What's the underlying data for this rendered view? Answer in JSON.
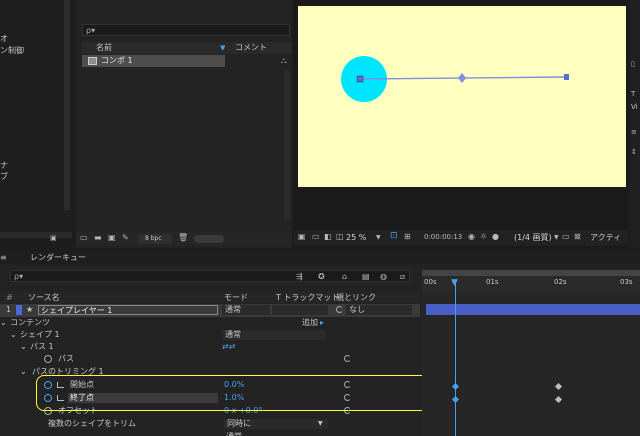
{
  "left_panel": {
    "frag1": "オ",
    "frag2": "ン制御",
    "frag3": "ナ",
    "frag4": "ブ"
  },
  "project": {
    "search_placeholder": "ρ▾",
    "col_name": "名前",
    "col_comment": "コメント",
    "item_name": "コンポ 1",
    "bpc": "8 bpc"
  },
  "viewer": {
    "zoom": "25 %",
    "timecode": "0:00:00:13",
    "resolution": "(1/4 画質)",
    "active": "アクティ",
    "right_frag": "Vi"
  },
  "timeline": {
    "tab_label": "レンダーキュー",
    "search_placeholder": "ρ▾",
    "col_source": "ソース名",
    "col_mode": "モード",
    "col_track": "T  トラックマット",
    "col_parent": "親とリンク",
    "ruler": [
      "00s",
      "01s",
      "02s",
      "03s"
    ],
    "layer": {
      "index": "1",
      "name": "シェイプレイヤー 1",
      "mode": "通常",
      "parent": "なし"
    },
    "contents": "コンテンツ",
    "add_label": "追加",
    "shape1": "シェイプ 1",
    "shape1_mode": "通常",
    "path1": "パス 1",
    "path": "パス",
    "trim": "パスのトリミング 1",
    "start_label": "開始点",
    "start_value": "0.0%",
    "end_label": "終了点",
    "end_value": "1.0%",
    "offset_label": "オフセット",
    "offset_value": "0 x +0.0°",
    "multi_trim": "複数のシェイプをトリム",
    "multi_trim_value": "同時に",
    "bottom_value": "通常"
  },
  "colors": {
    "canvas_bg": "#ffffc0",
    "circle": "#00e5ff",
    "path_line": "#7e8fe0",
    "highlight": "#ffff33",
    "accent": "#4a9ff0"
  }
}
